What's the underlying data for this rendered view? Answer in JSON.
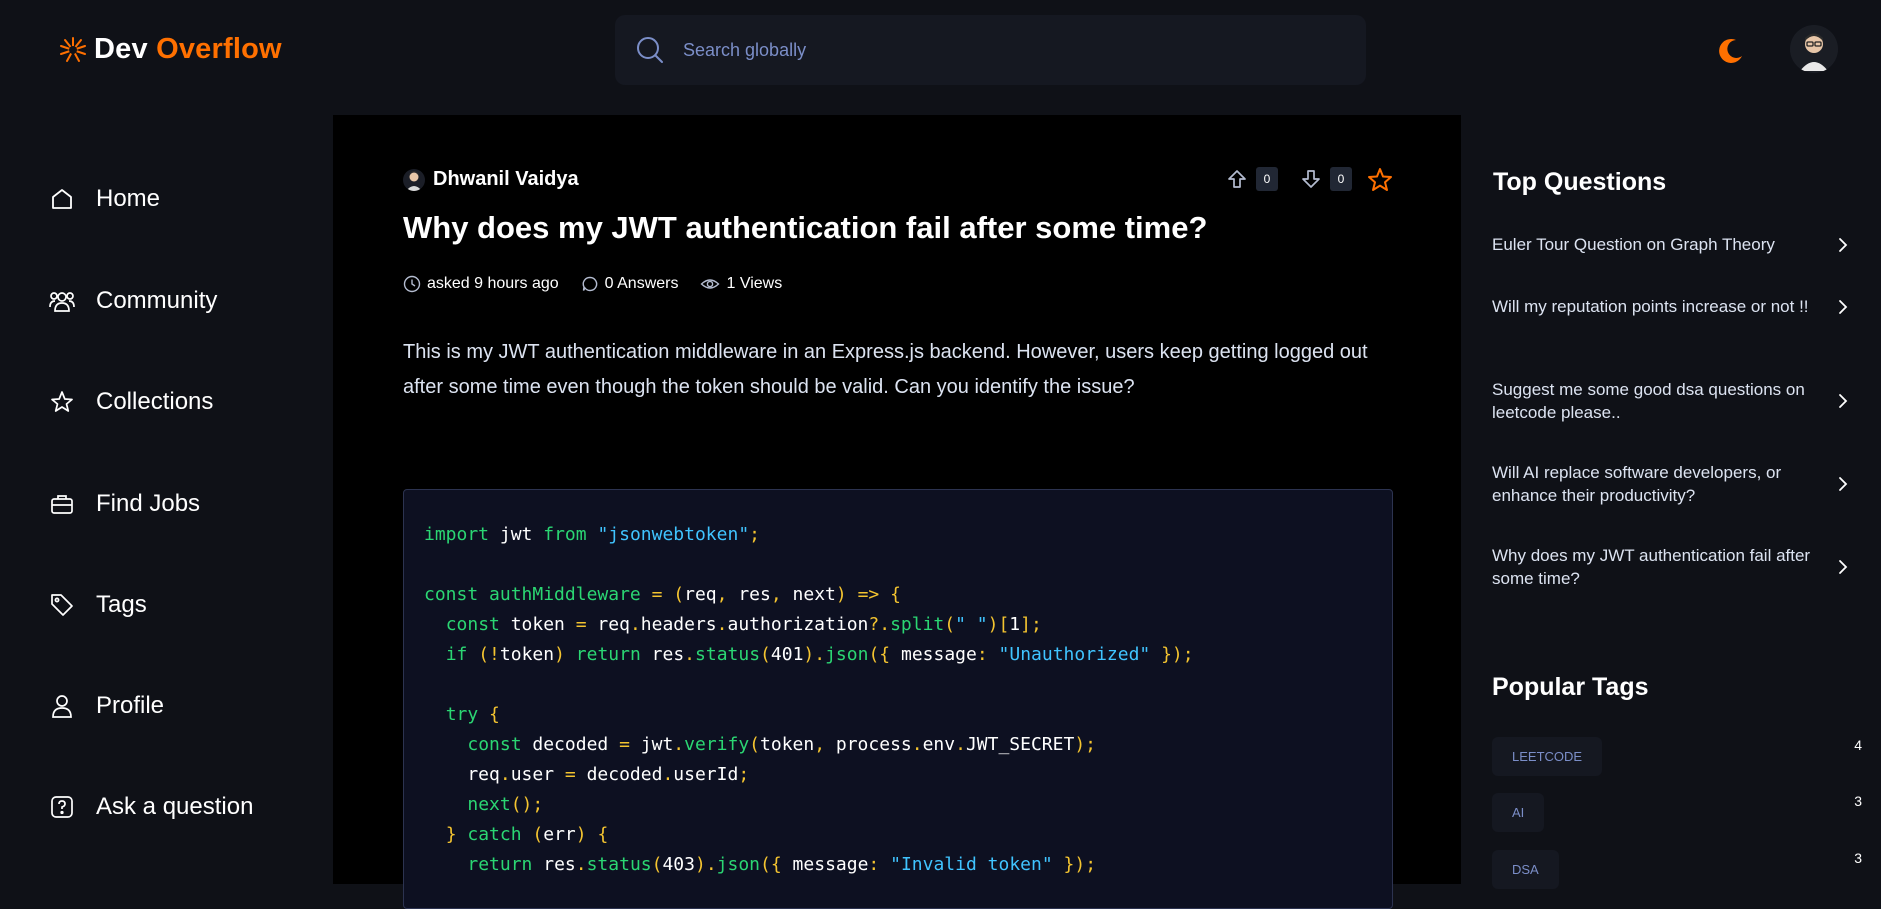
{
  "brand": {
    "part1": "Dev",
    "part2": "Overflow",
    "accent": "#ff7000"
  },
  "search": {
    "placeholder": "Search globally"
  },
  "header": {
    "theme_icon": "moon-icon",
    "avatar": "user-avatar"
  },
  "sidebar": {
    "items": [
      {
        "label": "Home",
        "icon": "home-icon"
      },
      {
        "label": "Community",
        "icon": "users-icon"
      },
      {
        "label": "Collections",
        "icon": "star-icon"
      },
      {
        "label": "Find Jobs",
        "icon": "briefcase-icon"
      },
      {
        "label": "Tags",
        "icon": "tag-icon"
      },
      {
        "label": "Profile",
        "icon": "user-icon"
      },
      {
        "label": "Ask a question",
        "icon": "question-icon"
      }
    ]
  },
  "question": {
    "author": "Dhwanil Vaidya",
    "upvotes": "0",
    "downvotes": "0",
    "title": "Why does my JWT authentication fail after some time?",
    "asked": "asked 9 hours ago",
    "answers": "0 Answers",
    "views": "1 Views",
    "body": "This is my JWT authentication middleware in an Express.js backend. However, users keep getting logged out after some time even though the token should be valid. Can you identify the issue?",
    "code_lines": [
      "import jwt from \"jsonwebtoken\";",
      "",
      "const authMiddleware = (req, res, next) => {",
      "  const token = req.headers.authorization?.split(\" \")[1];",
      "  if (!token) return res.status(401).json({ message: \"Unauthorized\" });",
      "",
      "  try {",
      "    const decoded = jwt.verify(token, process.env.JWT_SECRET);",
      "    req.user = decoded.userId;",
      "    next();",
      "  } catch (err) {",
      "    return res.status(403).json({ message: \"Invalid token\" });"
    ]
  },
  "right": {
    "top_title": "Top Questions",
    "top_questions": [
      "Euler Tour Question on Graph Theory",
      "Will my reputation points increase or not !!",
      "Suggest me some good dsa questions on leetcode please..",
      "Will AI replace software developers, or enhance their productivity?",
      "Why does my JWT authentication fail after some time?"
    ],
    "tags_title": "Popular Tags",
    "tags": [
      {
        "name": "LEETCODE",
        "count": "4"
      },
      {
        "name": "AI",
        "count": "3"
      },
      {
        "name": "DSA",
        "count": "3"
      }
    ]
  }
}
